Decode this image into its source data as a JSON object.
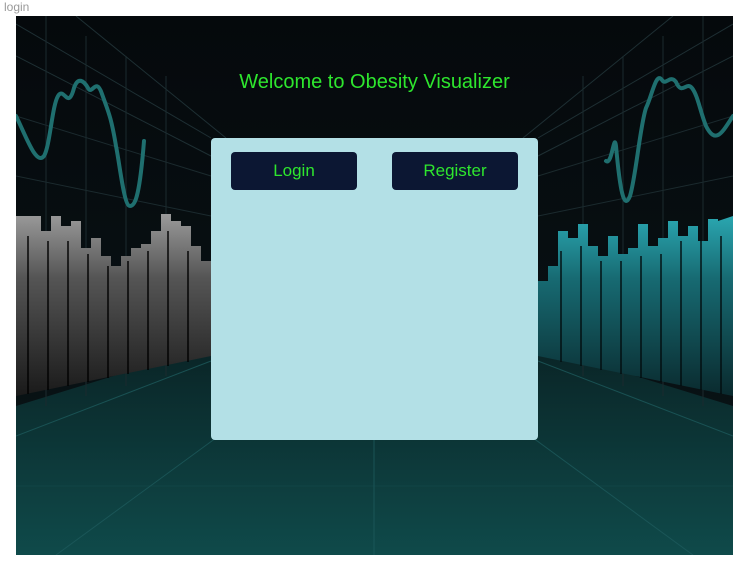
{
  "page": {
    "label": "login"
  },
  "header": {
    "title": "Welcome to Obesity Visualizer"
  },
  "auth_panel": {
    "login_label": "Login",
    "register_label": "Register"
  },
  "colors": {
    "accent_text": "#2ee62e",
    "button_bg": "#0c1733",
    "panel_bg": "#b3e0e6",
    "background_dark": "#060b0e",
    "background_teal": "#0f4a4a"
  }
}
